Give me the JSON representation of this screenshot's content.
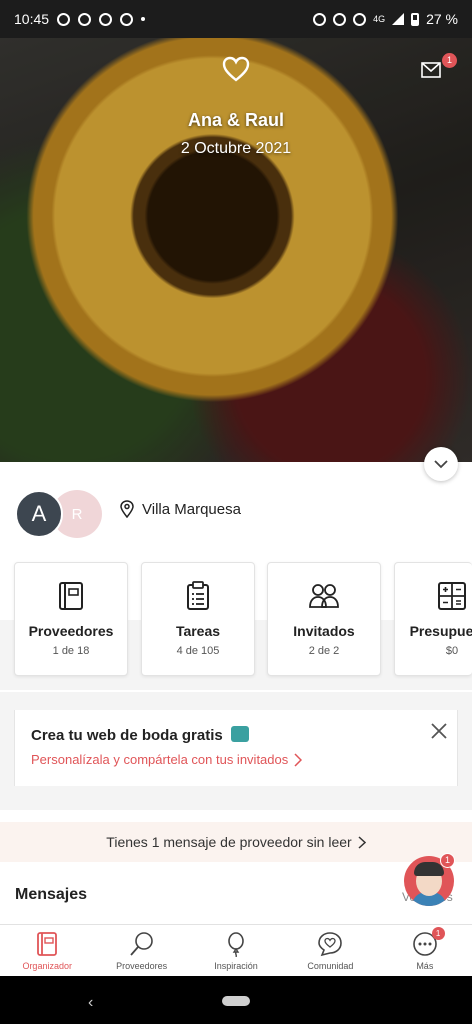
{
  "status_bar": {
    "time": "10:45",
    "battery": "27 %",
    "network": "4G"
  },
  "header": {
    "couple_names": "Ana & Raul",
    "wedding_date": "2 Octubre 2021",
    "inbox_badge": "1",
    "icons": {
      "logo": "heart-icon",
      "inbox": "mail-icon",
      "collapse": "chevron-down-icon"
    }
  },
  "profile": {
    "avatar_1_initial": "A",
    "avatar_2_initial": "R",
    "location": "Villa Marquesa"
  },
  "cards": [
    {
      "title": "Proveedores",
      "count": "1 de 18",
      "icon": "notebook-icon"
    },
    {
      "title": "Tareas",
      "count": "4 de 105",
      "icon": "clipboard-icon"
    },
    {
      "title": "Invitados",
      "count": "2 de 2",
      "icon": "guests-icon"
    },
    {
      "title": "Presupuesto",
      "count": "$0",
      "icon": "calculator-icon"
    }
  ],
  "promo": {
    "title": "Crea tu web de boda gratis",
    "link": "Personalízala y compártela con tus invitados"
  },
  "unread_notice": "Tienes 1 mensaje de proveedor sin leer",
  "messages": {
    "heading": "Mensajes",
    "partial_link": "Ver todos",
    "assistant_badge": "1"
  },
  "bottom_nav": [
    {
      "label": "Organizador",
      "icon": "notebook-icon",
      "active": true
    },
    {
      "label": "Proveedores",
      "icon": "search-icon",
      "active": false
    },
    {
      "label": "Inspiración",
      "icon": "balloon-icon",
      "active": false
    },
    {
      "label": "Comunidad",
      "icon": "chat-heart-icon",
      "active": false
    },
    {
      "label": "Más",
      "icon": "more-icon",
      "active": false,
      "badge": "1"
    }
  ],
  "colors": {
    "accent": "#e05558",
    "avatar_dark": "#3d4650",
    "avatar_light": "#f0d6d8"
  }
}
